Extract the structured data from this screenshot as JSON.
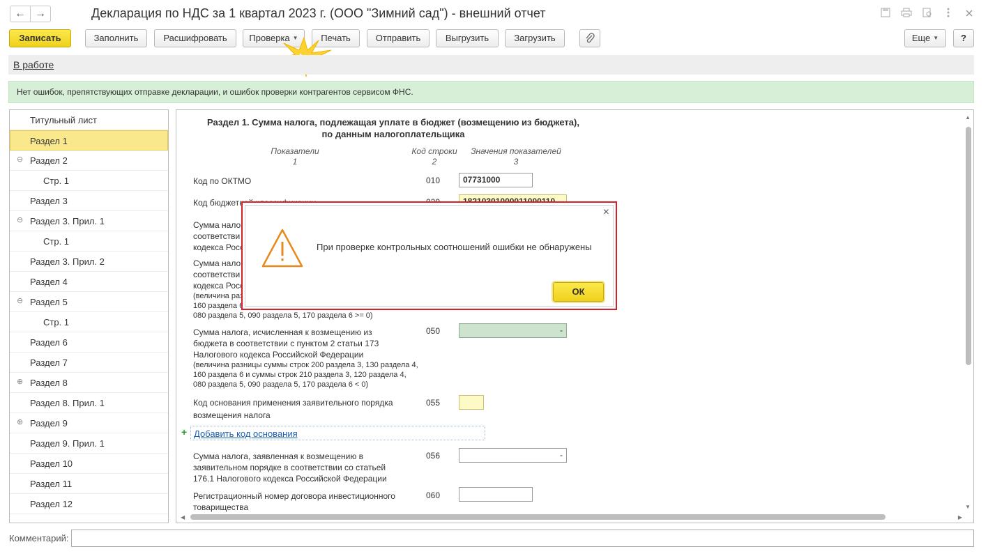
{
  "window": {
    "title": "Декларация по НДС за 1 квартал 2023 г. (ООО \"Зимний сад\") - внешний отчет",
    "back_icon": "←",
    "forward_icon": "→"
  },
  "toolbar": {
    "save": "Записать",
    "fill": "Заполнить",
    "decode": "Расшифровать",
    "check": "Проверка",
    "print": "Печать",
    "send": "Отправить",
    "export": "Выгрузить",
    "import": "Загрузить",
    "more": "Еще",
    "help": "?"
  },
  "status": {
    "link": "В работе"
  },
  "info": {
    "text": "Нет ошибок, препятствующих отправке декларации, и ошибок проверки контрагентов сервисом ФНС."
  },
  "sidebar": {
    "items": [
      {
        "label": "Титульный лист"
      },
      {
        "label": "Раздел 1"
      },
      {
        "label": "Раздел 2",
        "toggle": "⊖"
      },
      {
        "label": "Стр. 1"
      },
      {
        "label": "Раздел 3"
      },
      {
        "label": "Раздел 3. Прил. 1",
        "toggle": "⊖"
      },
      {
        "label": "Стр. 1"
      },
      {
        "label": "Раздел 3. Прил. 2"
      },
      {
        "label": "Раздел 4"
      },
      {
        "label": "Раздел 5",
        "toggle": "⊖"
      },
      {
        "label": "Стр. 1"
      },
      {
        "label": "Раздел 6"
      },
      {
        "label": "Раздел 7"
      },
      {
        "label": "Раздел 8",
        "toggle": "⊕"
      },
      {
        "label": "Раздел 8. Прил. 1"
      },
      {
        "label": "Раздел 9",
        "toggle": "⊕"
      },
      {
        "label": "Раздел 9. Прил. 1"
      },
      {
        "label": "Раздел 10"
      },
      {
        "label": "Раздел 11"
      },
      {
        "label": "Раздел 12"
      }
    ]
  },
  "section": {
    "title_line1": "Раздел 1. Сумма налога, подлежащая уплате в бюджет (возмещению из бюджета),",
    "title_line2": "по данным налогоплательщика",
    "col1": "Показатели",
    "col1_num": "1",
    "col2": "Код строки",
    "col2_num": "2",
    "col3": "Значения показателей",
    "col3_num": "3",
    "rows": {
      "oktmo": {
        "label": "Код по ОКТМО",
        "code": "010",
        "value": "07731000"
      },
      "kbk": {
        "label": "Код бюджетной классификации",
        "code": "020",
        "value": "18210301000011000110"
      },
      "r030_l1": "Сумма нало",
      "r030_l2": "соответстви",
      "r030_l3": "кодекса Росс",
      "r040_l1": "Сумма нало",
      "r040_l2": "соответстви",
      "r040_l3": "кодекса Росс",
      "r040_s1": "(величина разн",
      "r040_s2": "160 раздела 6",
      "r040_s3": "080 раздела 5, 090 раздела 5, 170 раздела 6 >= 0)",
      "r050": {
        "l1": "Сумма налога, исчисленная к возмещению из",
        "l2": "бюджета в соответствии с пунктом 2 статьи 173",
        "l3": "Налогового кодекса Российской Федерации",
        "s1": "(величина разницы суммы строк 200 раздела 3, 130 раздела 4,",
        "s2": "160 раздела 6 и суммы строк 210 раздела 3, 120 раздела 4,",
        "s3": "080 раздела 5, 090 раздела 5, 170 раздела 6 < 0)",
        "code": "050",
        "value": "-"
      },
      "r055": {
        "l1": "Код основания применения заявительного порядка",
        "l2": "возмещения налога",
        "code": "055"
      },
      "add_basis": "Добавить код основания",
      "r056": {
        "l1": "Сумма налога, заявленная к возмещению в",
        "l2": "заявительном порядке в соответствии со статьей",
        "l3": "176.1 Налогового кодекса Российской Федерации",
        "code": "056",
        "value": "-"
      },
      "r060": {
        "l1": "Регистрационный номер договора инвестиционного",
        "l2": "товарищества",
        "code": "060"
      }
    }
  },
  "comment": {
    "label": "Комментарий:"
  },
  "dialog": {
    "message": "При проверке контрольных соотношений ошибки не обнаружены",
    "ok": "ОК",
    "close": "×"
  },
  "colors": {
    "accent_yellow": "#f0d11d",
    "info_green": "#d7efd6",
    "dialog_border": "#d6202a",
    "warning_orange": "#e8891c"
  }
}
